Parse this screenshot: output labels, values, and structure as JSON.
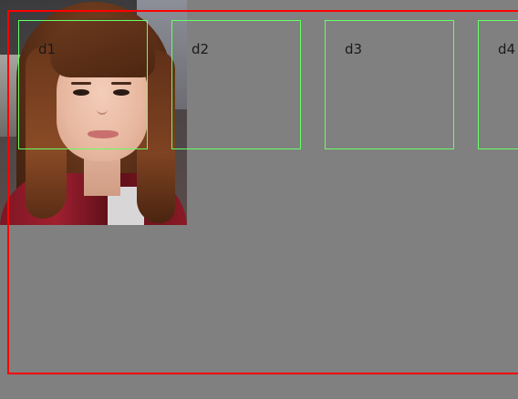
{
  "photo": {
    "description_icon": "portrait-photo"
  },
  "boxes": [
    {
      "label": "d1"
    },
    {
      "label": "d2"
    },
    {
      "label": "d3"
    },
    {
      "label": "d4"
    }
  ],
  "colors": {
    "background": "#808080",
    "frame": "#ff0000",
    "box_border": "#66ff66"
  }
}
